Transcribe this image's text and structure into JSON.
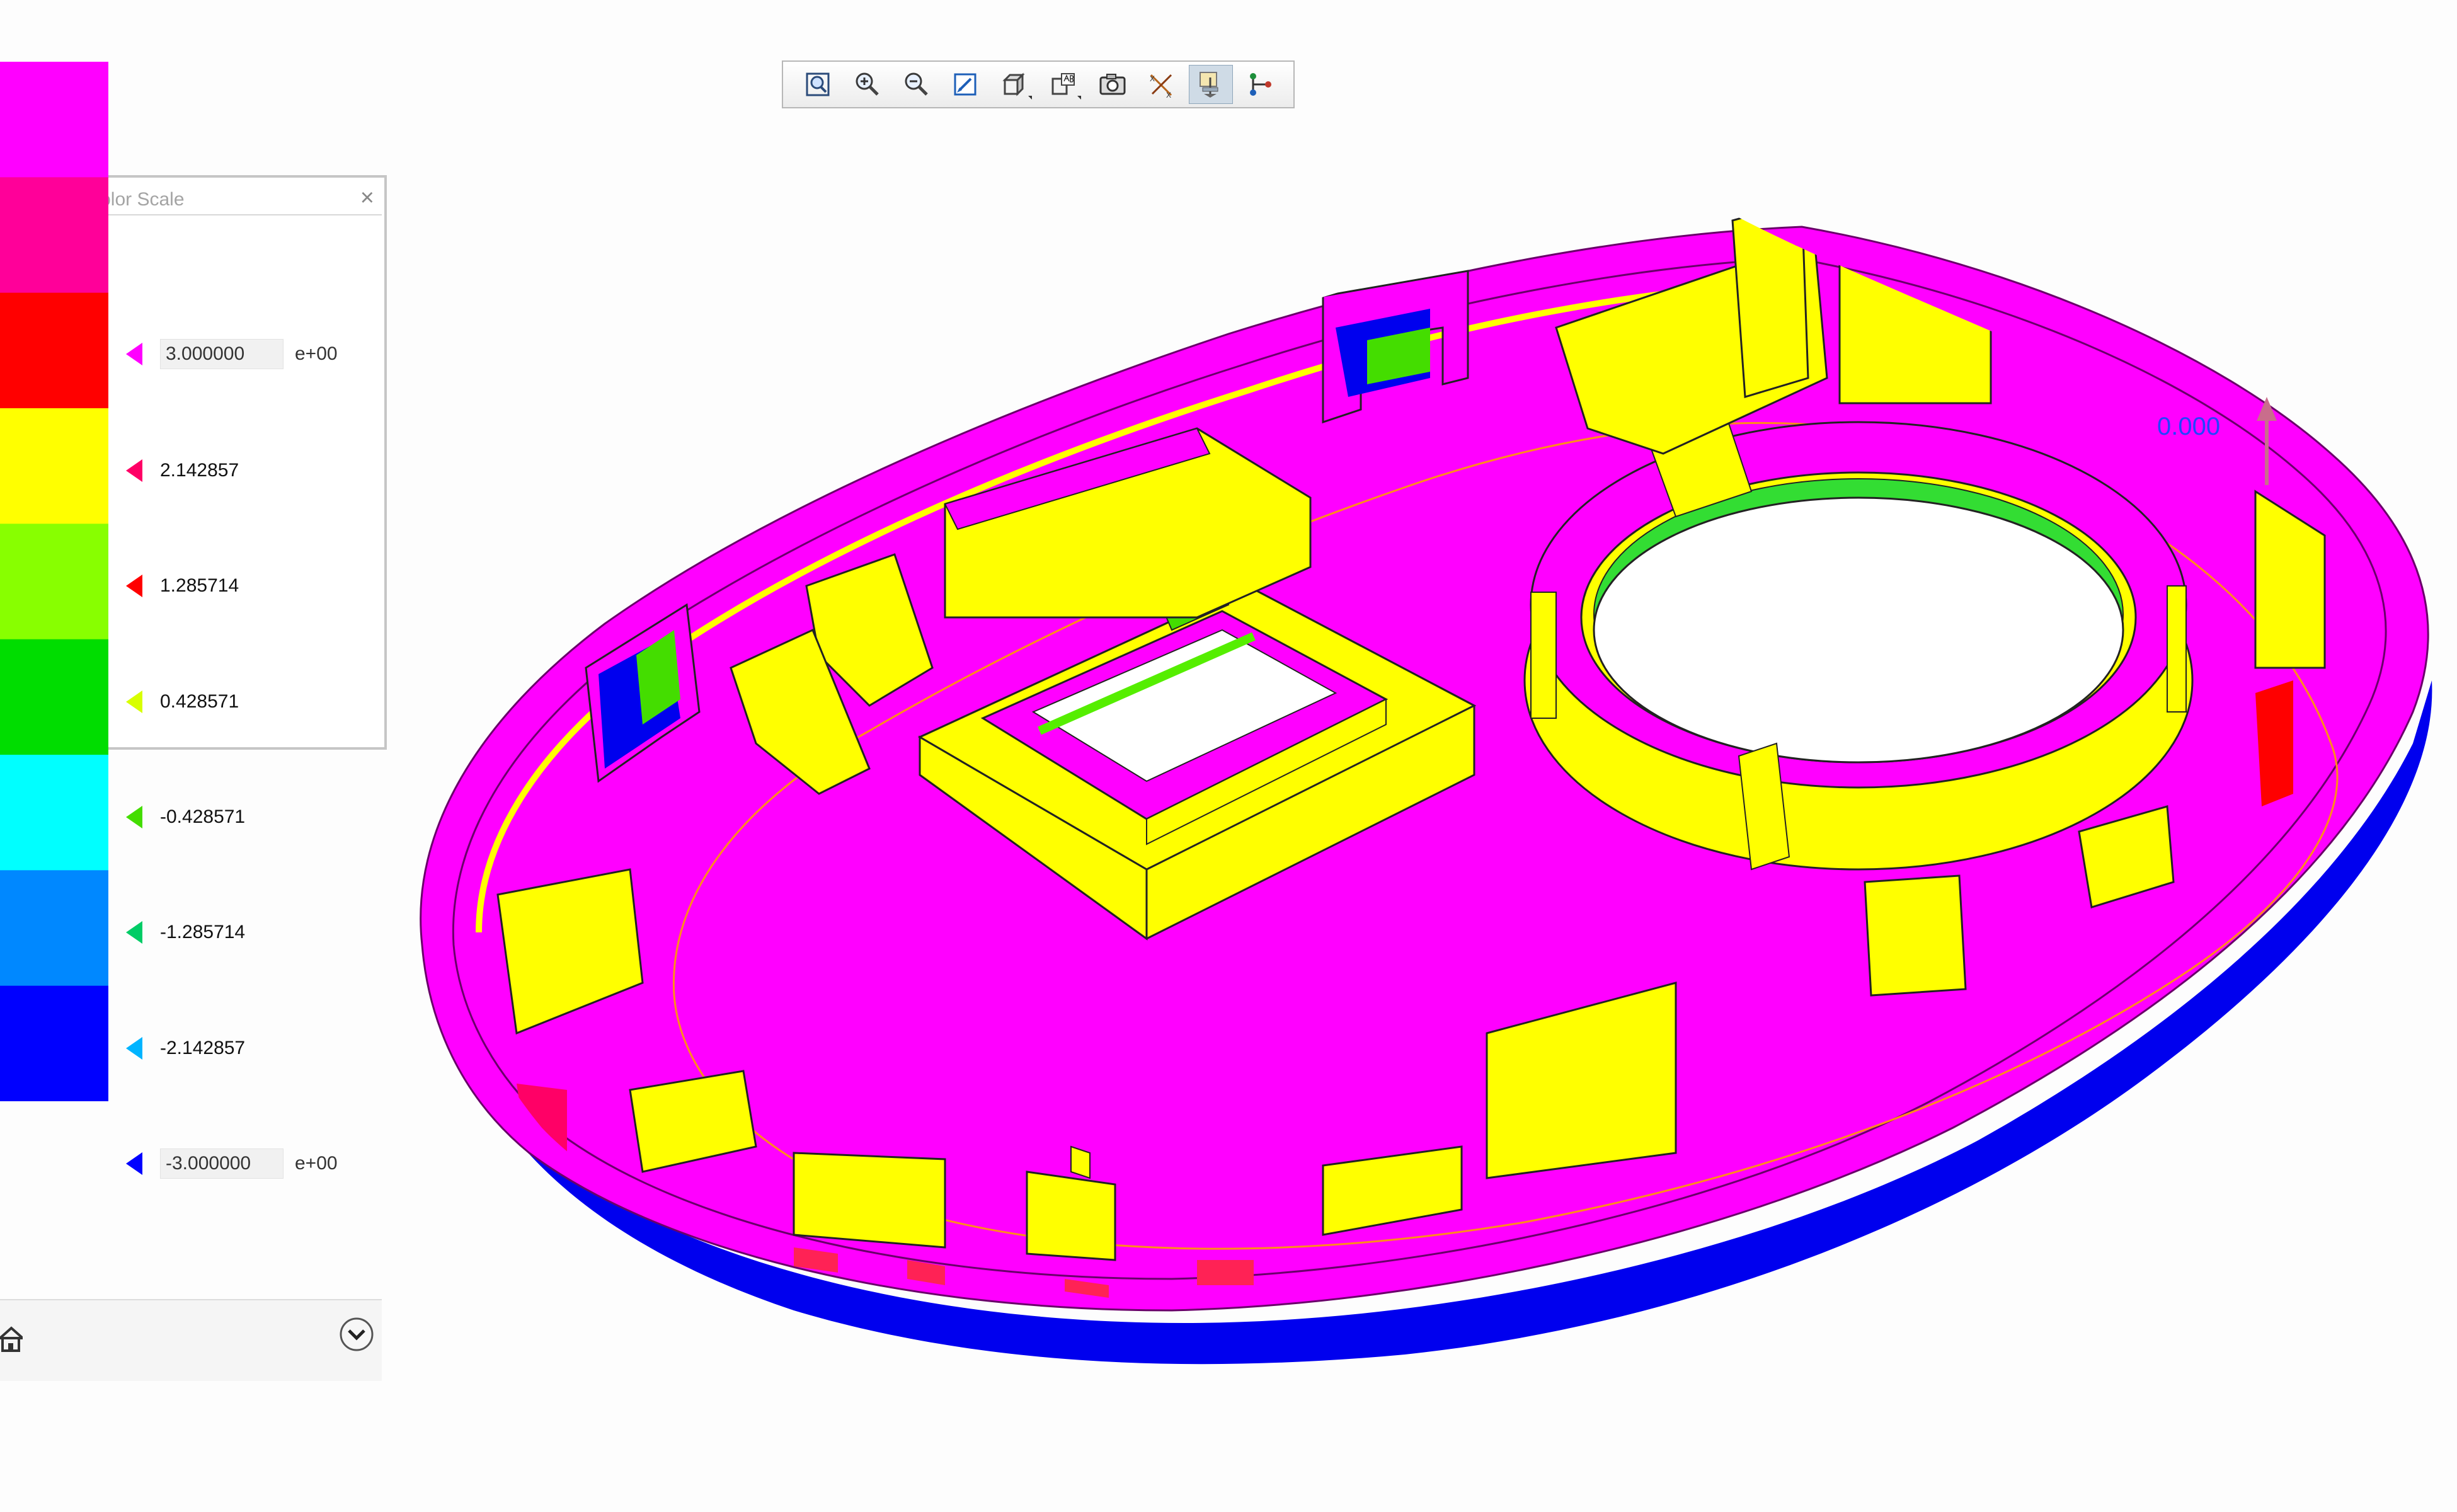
{
  "toolbar": {
    "buttons": [
      {
        "icon": "zoom-fit-icon"
      },
      {
        "icon": "zoom-in-icon"
      },
      {
        "icon": "zoom-out-icon"
      },
      {
        "icon": "repaint-icon"
      },
      {
        "icon": "view-orientation-icon"
      },
      {
        "icon": "saved-views-icon"
      },
      {
        "icon": "camera-icon"
      },
      {
        "icon": "display-datums-icon"
      },
      {
        "icon": "datum-display-icon",
        "active": true
      },
      {
        "icon": "node-tree-icon"
      }
    ]
  },
  "color_scale": {
    "title": "Color Scale",
    "close_label": "×",
    "levels": [
      {
        "value": "3.000000",
        "exponent": "e+00",
        "editable": true,
        "color": "#ff00ff"
      },
      {
        "value": "2.142857",
        "color": "#ff0066"
      },
      {
        "value": "1.285714",
        "color": "#ff0000"
      },
      {
        "value": "0.428571",
        "color": "#d8ff00"
      },
      {
        "value": "-0.428571",
        "color": "#44dd00"
      },
      {
        "value": "-1.285714",
        "color": "#00cc66"
      },
      {
        "value": "-2.142857",
        "color": "#00b4ff"
      },
      {
        "value": "-3.000000",
        "exponent": "e+00",
        "editable": true,
        "color": "#0000ff"
      }
    ],
    "bands": [
      "#ff00ff",
      "#ff0099",
      "#ff0000",
      "#ffff00",
      "#88ff00",
      "#00dd00",
      "#00ffff",
      "#0088ff",
      "#0000ff"
    ]
  },
  "model": {
    "draft_angle_label": "0.000",
    "colors": {
      "magenta": "#ff00ff",
      "yellow": "#ffff00",
      "blue": "#0000ee",
      "green": "#55ee00",
      "red": "#ff2255",
      "pull_arrow": "#c96d8c",
      "label_blue": "#2244ff"
    }
  }
}
